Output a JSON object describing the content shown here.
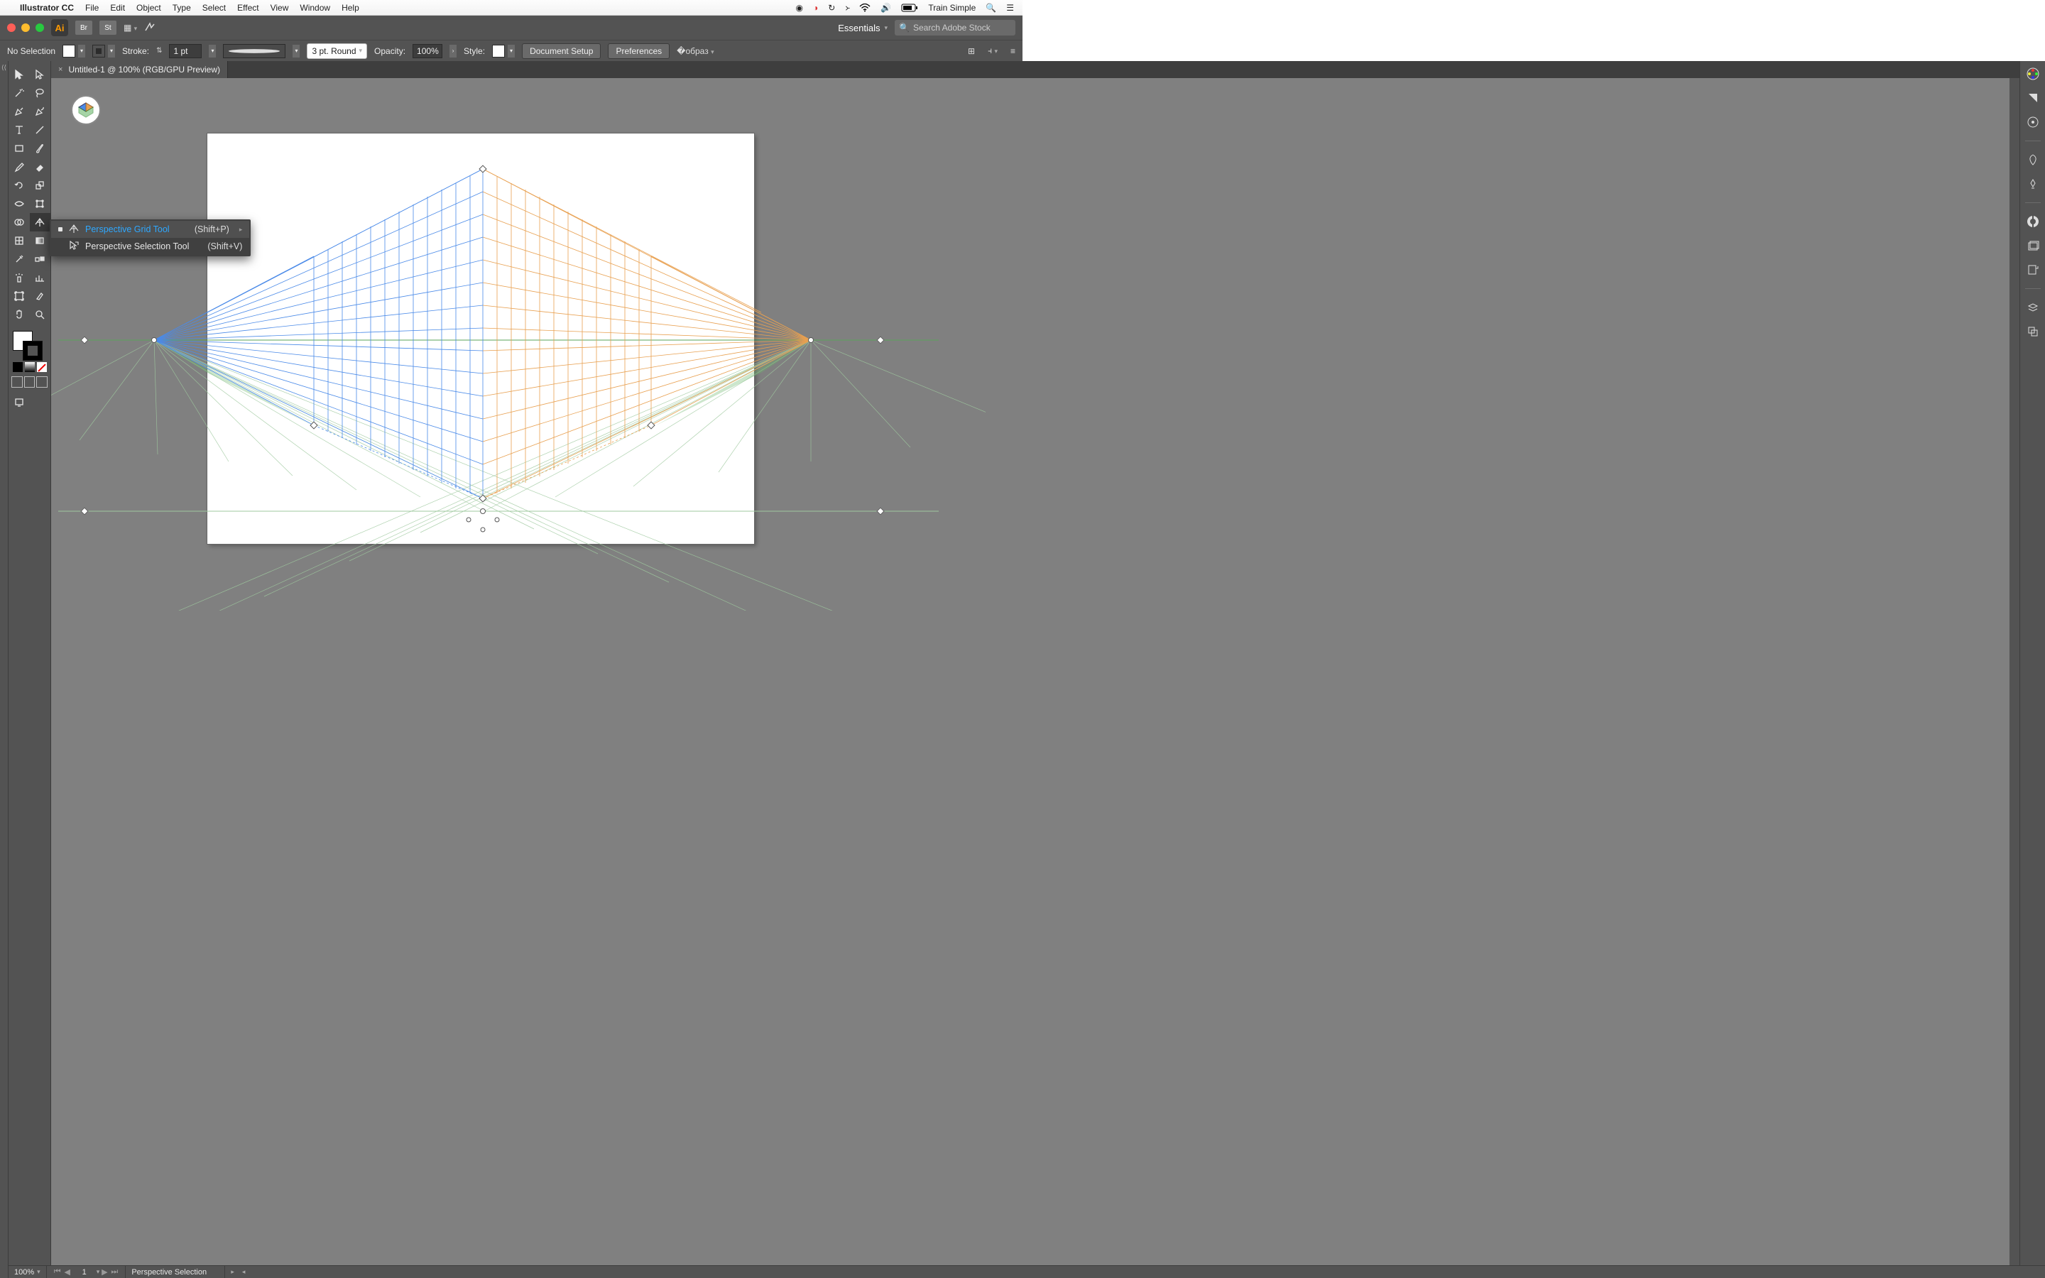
{
  "mac_menu": {
    "app": "Illustrator CC",
    "items": [
      "File",
      "Edit",
      "Object",
      "Type",
      "Select",
      "Effect",
      "View",
      "Window",
      "Help"
    ],
    "user": "Train Simple"
  },
  "titlebar": {
    "ai": "Ai",
    "chips": [
      "Br",
      "St"
    ],
    "workspace": "Essentials",
    "stock_placeholder": "Search Adobe Stock"
  },
  "control": {
    "selection_label": "No Selection",
    "stroke_label": "Stroke:",
    "stroke_value": "1 pt",
    "brush_value": "3 pt. Round",
    "opacity_label": "Opacity:",
    "opacity_value": "100%",
    "style_label": "Style:",
    "doc_setup": "Document Setup",
    "prefs": "Preferences"
  },
  "doc_tab": "Untitled-1 @ 100% (RGB/GPU Preview)",
  "flyout": {
    "items": [
      {
        "label": "Perspective Grid Tool",
        "shortcut": "(Shift+P)",
        "selected": true
      },
      {
        "label": "Perspective Selection Tool",
        "shortcut": "(Shift+V)",
        "selected": false
      }
    ]
  },
  "status": {
    "zoom": "100%",
    "artboard": "1",
    "info": "Perspective Selection"
  }
}
